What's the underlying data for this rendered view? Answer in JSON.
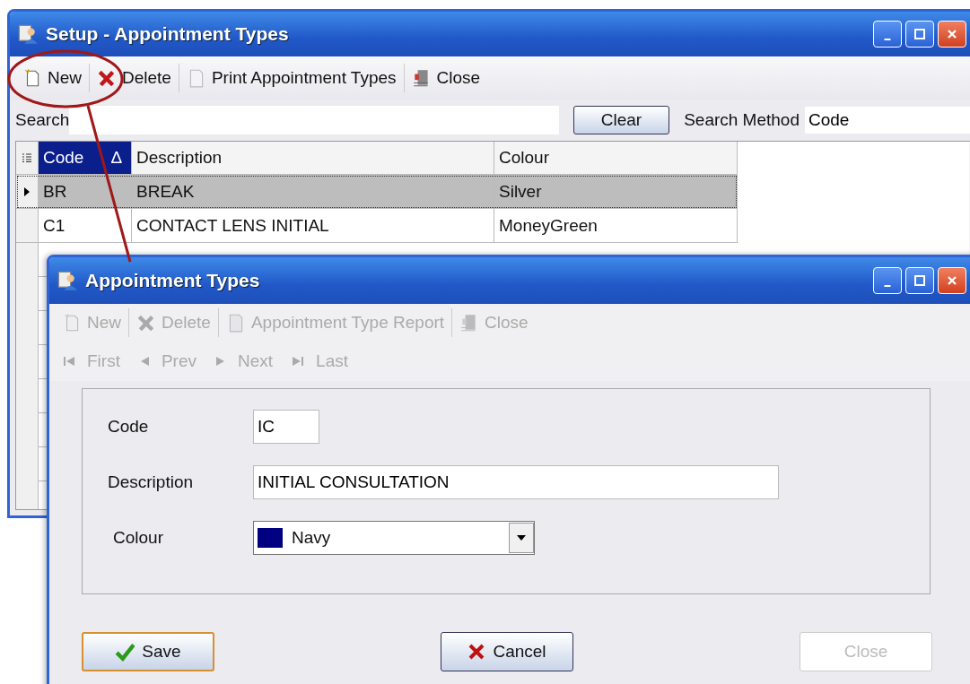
{
  "setup_window": {
    "title": "Setup - Appointment Types",
    "toolbar": [
      {
        "kind": "new",
        "label": "New",
        "disabled": false
      },
      {
        "kind": "delete",
        "label": "Delete",
        "disabled": false
      },
      {
        "kind": "print",
        "label": "Print Appointment Types",
        "disabled": false
      },
      {
        "kind": "close",
        "label": "Close",
        "disabled": false
      }
    ],
    "search": {
      "label": "Search"
    },
    "clear_button": {
      "label": "Clear"
    },
    "search_method": {
      "label": "Search Method",
      "value": "Code"
    },
    "table": {
      "columns": [
        {
          "label": "Code",
          "sort_indicator": "Δ",
          "selected": true
        },
        {
          "label": "Description",
          "selected": false
        },
        {
          "label": "Colour",
          "selected": false
        }
      ],
      "rows": [
        {
          "selected": true,
          "cells": [
            "BR",
            "BREAK",
            "Silver"
          ]
        },
        {
          "selected": false,
          "cells": [
            "C1",
            "CONTACT LENS INITIAL",
            "MoneyGreen"
          ]
        }
      ]
    }
  },
  "dialog": {
    "title": "Appointment Types",
    "toolbar": [
      {
        "kind": "new",
        "label": "New",
        "disabled": true
      },
      {
        "kind": "delete",
        "label": "Delete",
        "disabled": true
      },
      {
        "kind": "print",
        "label": "Appointment Type Report",
        "disabled": true
      },
      {
        "kind": "close",
        "label": "Close",
        "disabled": true
      }
    ],
    "navigation": [
      {
        "kind": "first",
        "label": "First"
      },
      {
        "kind": "prev",
        "label": "Prev"
      },
      {
        "kind": "next",
        "label": "Next"
      },
      {
        "kind": "last",
        "label": "Last"
      }
    ],
    "fields": [
      {
        "kind": "short",
        "label": "Code",
        "value": "IC"
      },
      {
        "kind": "wide",
        "label": "Description",
        "value": "INITIAL CONSULTATION"
      },
      {
        "kind": "colour",
        "label": "Colour",
        "value": "Navy",
        "color": "#000080"
      }
    ],
    "buttons": [
      {
        "kind": "save",
        "label": "Save",
        "disabled": false
      },
      {
        "kind": "cancel",
        "label": "Cancel",
        "disabled": false
      },
      {
        "kind": "close",
        "label": "Close",
        "disabled": true
      }
    ]
  }
}
